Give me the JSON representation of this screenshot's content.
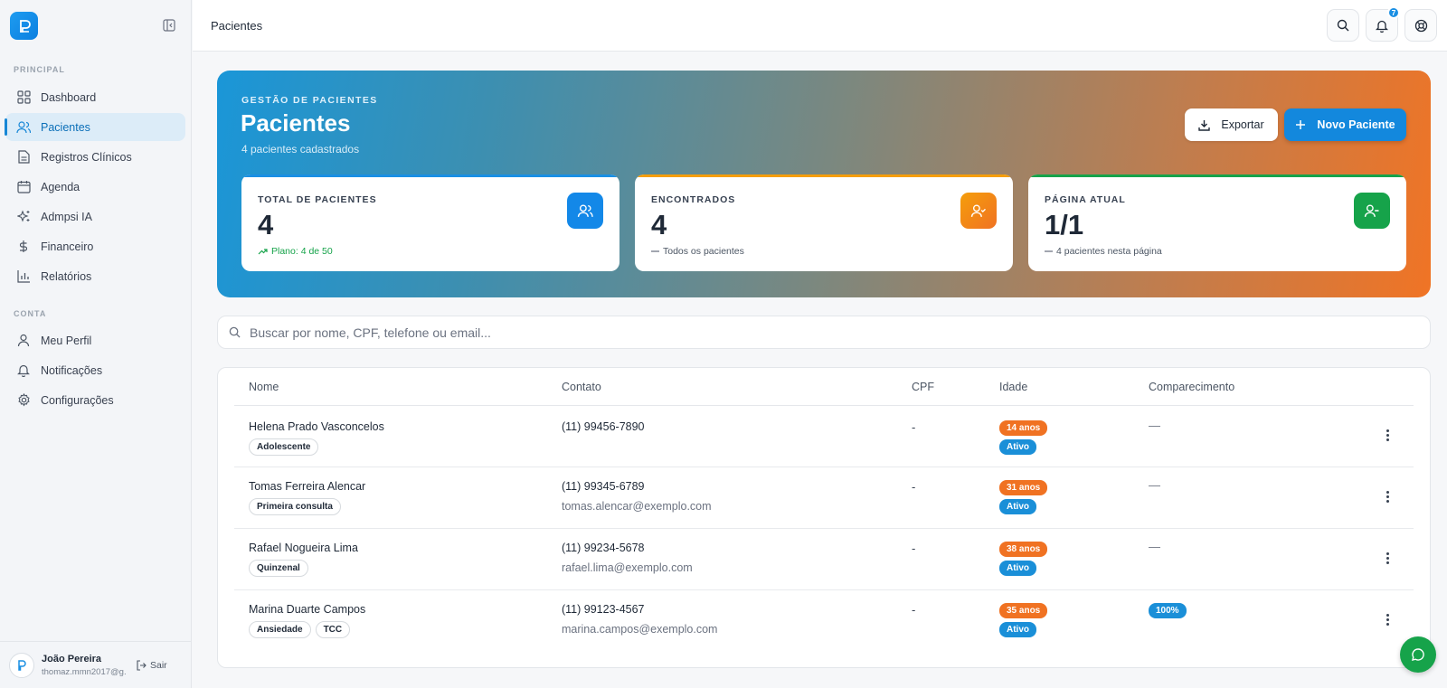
{
  "sidebar": {
    "section_principal": "PRINCIPAL",
    "section_conta": "CONTA",
    "items": [
      {
        "label": "Dashboard",
        "icon": "grid-icon"
      },
      {
        "label": "Pacientes",
        "icon": "users-icon",
        "active": true
      },
      {
        "label": "Registros Clínicos",
        "icon": "file-text-icon"
      },
      {
        "label": "Agenda",
        "icon": "calendar-icon"
      },
      {
        "label": "Admpsi IA",
        "icon": "sparkles-icon"
      },
      {
        "label": "Financeiro",
        "icon": "dollar-icon"
      },
      {
        "label": "Relatórios",
        "icon": "bar-chart-icon"
      }
    ],
    "account_items": [
      {
        "label": "Meu Perfil",
        "icon": "user-icon"
      },
      {
        "label": "Notificações",
        "icon": "bell-icon"
      },
      {
        "label": "Configurações",
        "icon": "gear-icon"
      }
    ],
    "user": {
      "name": "João Pereira",
      "email": "thomaz.mmn2017@g...",
      "logout": "Sair"
    }
  },
  "topbar": {
    "title": "Pacientes",
    "notification_count": "7"
  },
  "hero": {
    "eyebrow": "GESTÃO DE PACIENTES",
    "title": "Pacientes",
    "subtitle": "4 pacientes cadastrados",
    "export_label": "Exportar",
    "new_label": "Novo Paciente",
    "stats": [
      {
        "label": "TOTAL DE PACIENTES",
        "value": "4",
        "foot": "Plano: 4 de 50"
      },
      {
        "label": "ENCONTRADOS",
        "value": "4",
        "foot": "Todos os pacientes"
      },
      {
        "label": "PÁGINA ATUAL",
        "value": "1/1",
        "foot": "4 pacientes nesta página"
      }
    ]
  },
  "search": {
    "placeholder": "Buscar por nome, CPF, telefone ou email..."
  },
  "table": {
    "headers": [
      "Nome",
      "Contato",
      "CPF",
      "Idade",
      "Comparecimento"
    ],
    "rows": [
      {
        "name": "Helena Prado Vasconcelos",
        "tags": [
          "Adolescente"
        ],
        "phone": "(11) 99456-7890",
        "email": "",
        "cpf": "-",
        "age": "14 anos",
        "status": "Ativo",
        "attendance": "—"
      },
      {
        "name": "Tomas Ferreira Alencar",
        "tags": [
          "Primeira consulta"
        ],
        "phone": "(11) 99345-6789",
        "email": "tomas.alencar@exemplo.com",
        "cpf": "-",
        "age": "31 anos",
        "status": "Ativo",
        "attendance": "—"
      },
      {
        "name": "Rafael Nogueira Lima",
        "tags": [
          "Quinzenal"
        ],
        "phone": "(11) 99234-5678",
        "email": "rafael.lima@exemplo.com",
        "cpf": "-",
        "age": "38 anos",
        "status": "Ativo",
        "attendance": "—"
      },
      {
        "name": "Marina Duarte Campos",
        "tags": [
          "Ansiedade",
          "TCC"
        ],
        "phone": "(11) 99123-4567",
        "email": "marina.campos@exemplo.com",
        "cpf": "-",
        "age": "35 anos",
        "status": "Ativo",
        "attendance": "100%"
      }
    ]
  },
  "colors": {
    "primary": "#1388dd",
    "accent_orange": "#f07222",
    "success": "#16a34a"
  }
}
